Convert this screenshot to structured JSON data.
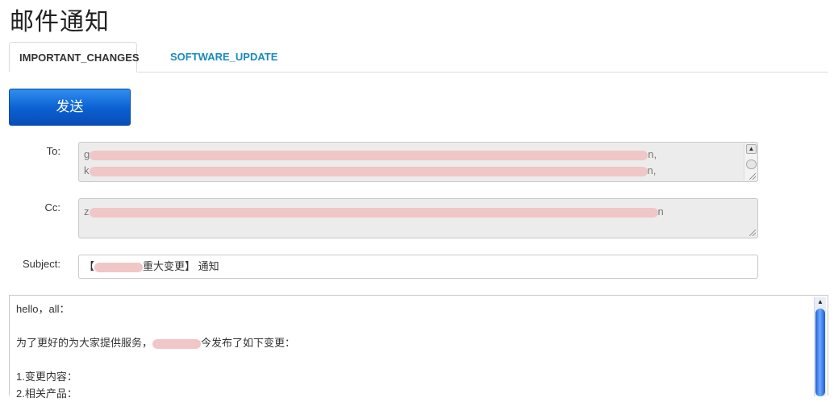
{
  "page": {
    "title": "邮件通知"
  },
  "tabs": [
    {
      "label": "IMPORTANT_CHANGES",
      "active": true
    },
    {
      "label": "SOFTWARE_UPDATE",
      "active": false
    }
  ],
  "actions": {
    "send_label": "发送"
  },
  "form": {
    "to_label": "To:",
    "to_lines": [
      {
        "start": "g",
        "end": "n,"
      },
      {
        "start": "k",
        "end": "n,"
      }
    ],
    "cc_label": "Cc:",
    "cc_line": {
      "start": "z",
      "end": "n"
    },
    "subject_label": "Subject:",
    "subject_prefix": "【",
    "subject_suffix": "重大变更】 通知"
  },
  "body": {
    "greeting": "hello，all：",
    "intro_prefix": "为了更好的为大家提供服务，",
    "intro_suffix": "今发布了如下变更：",
    "item1": "1.变更内容：",
    "item2": "2.相关产品："
  },
  "colors": {
    "tab_link": "#1a8ac0",
    "send_button": "#0b5fd0",
    "redaction": "#f0c6c6"
  },
  "icons": {
    "scroll_up": "triangle-up",
    "scroll_down": "triangle-down"
  }
}
